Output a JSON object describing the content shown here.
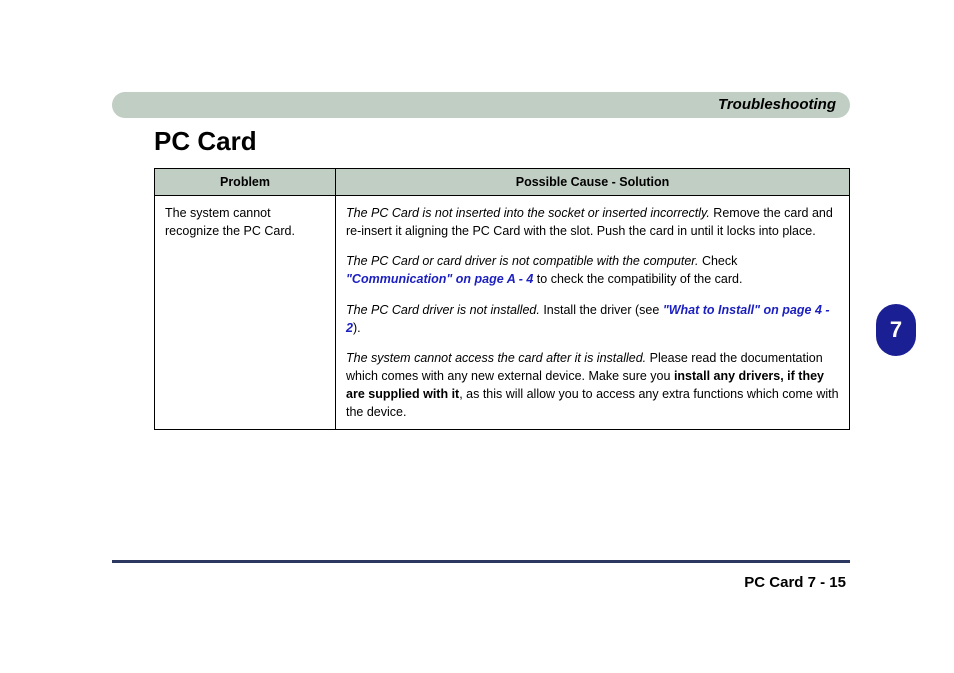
{
  "header": {
    "right_title": "Troubleshooting"
  },
  "section": {
    "title": "PC Card"
  },
  "table": {
    "headers": {
      "problem": "Problem",
      "solution": "Possible Cause - Solution"
    },
    "row": {
      "problem": "The system cannot recognize the PC Card.",
      "s1_lead": "The PC Card is not inserted into the socket or inserted incorrectly.",
      "s1_body": " Remove the card and re-insert it aligning the PC Card with the slot. Push the card in until it locks into place.",
      "s2_lead": "The PC Card or card driver is not compatible with the computer.",
      "s2_body_a": " Check ",
      "s2_link": "\"Communication\" on page  A - 4",
      "s2_body_b": " to check the compatibility of the card.",
      "s3_lead": "The PC Card driver is not installed.",
      "s3_body_a": " Install the driver (see ",
      "s3_link": "\"What to Install\" on page 4 - 2",
      "s3_body_b": ").",
      "s4_lead": "The system cannot access the card after it is installed.",
      "s4_body_a": " Please read the documentation which comes with any new external device. Make sure you ",
      "s4_bold": "install any drivers, if they are supplied with it",
      "s4_body_b": ", as this will allow you to access any extra functions which come with the device."
    }
  },
  "chapter": {
    "number": "7"
  },
  "footer": {
    "text": "PC Card 7 - 15"
  }
}
